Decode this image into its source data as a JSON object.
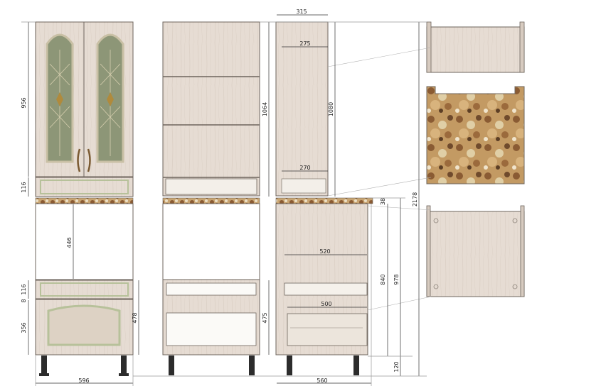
{
  "dimensions": {
    "total_width_front": "596",
    "upper_glass_height": "956",
    "upper_drawer_height": "116",
    "niche_height": "446",
    "lower_drawer_height": "116",
    "gap_small": "8",
    "bottom_drawer_height": "356",
    "bottom_drawer_inner": "478",
    "inner_tall_height": "1064",
    "inner_drawer_height": "475",
    "side_depth_top": "315",
    "side_shelf_top": "275",
    "side_height_upper": "1080",
    "side_shelf_bottom": "270",
    "counter_thickness": "38",
    "base_depth": "560",
    "base_shelf_depth": "520",
    "base_drawer_depth": "500",
    "base_height_carcass": "840",
    "base_height_total": "978",
    "leg_height": "120",
    "overall_height": "2178"
  },
  "colors": {
    "carcass": "#e6dcd3",
    "carcass_shade": "#d7cbc0",
    "frame_line": "#6d645c",
    "glass": "#8d9677",
    "glass_frame": "#c9c0a5",
    "panel_green": "#b7c19a",
    "counter_stone": "#c39a63",
    "leg": "#2c2c2c",
    "handle": "#7a5a32"
  }
}
